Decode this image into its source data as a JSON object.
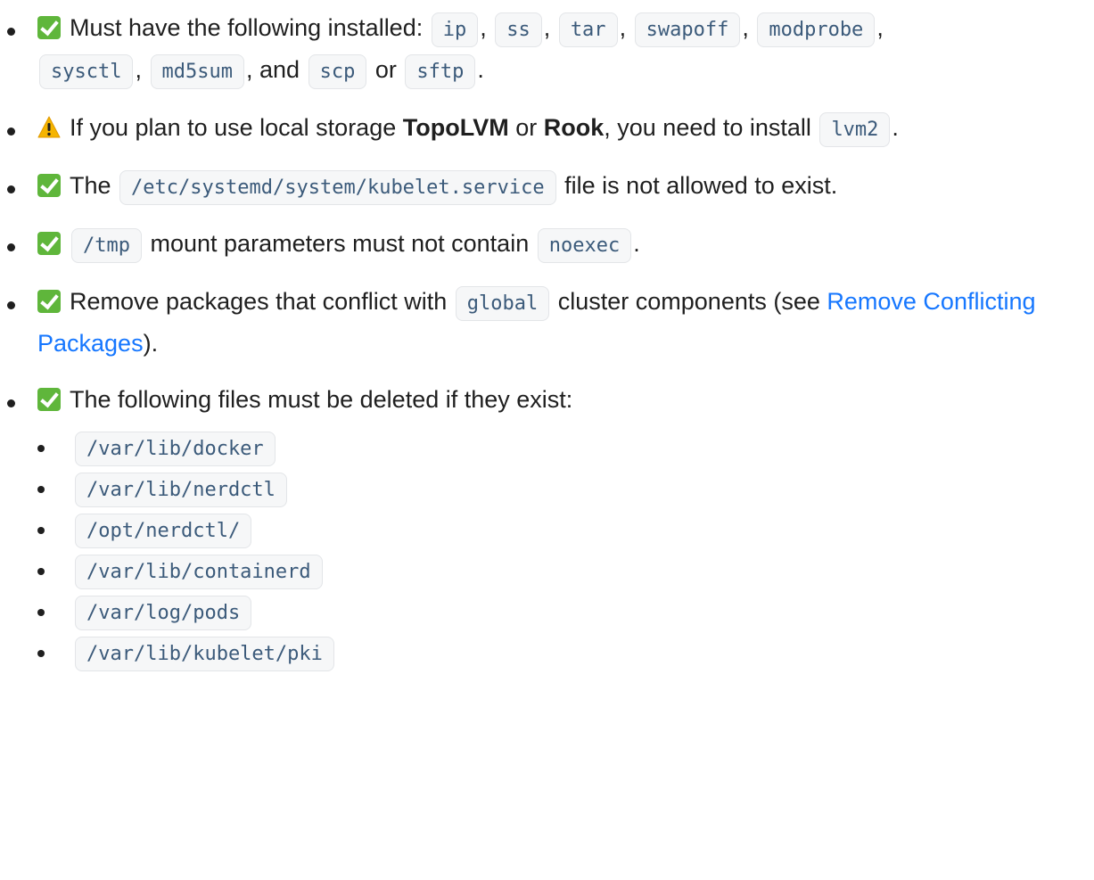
{
  "items": {
    "req1": {
      "text_a": "Must have the following installed:",
      "tools": [
        "ip",
        "ss",
        "tar",
        "swapoff",
        "modprobe",
        "sysctl",
        "md5sum",
        "scp",
        "sftp"
      ],
      "comma": ",",
      "and": ", and",
      "or": "or",
      "period": "."
    },
    "req2": {
      "text_a": "If you plan to use local storage",
      "topolvm": "TopoLVM",
      "or": "or",
      "rook": "Rook",
      "text_b": ", you need to install",
      "pkg": "lvm2",
      "period": "."
    },
    "req3": {
      "text_a": "The",
      "path": "/etc/systemd/system/kubelet.service",
      "text_b": "file is not allowed to exist."
    },
    "req4": {
      "path": "/tmp",
      "text_a": "mount parameters must not contain",
      "flag": "noexec",
      "period": "."
    },
    "req5": {
      "text_a": "Remove packages that conflict with",
      "cluster": "global",
      "text_b": "cluster components (see",
      "link": "Remove Conflicting Packages",
      "text_c": ")."
    },
    "req6": {
      "text_a": "The following files must be deleted if they exist:",
      "files": [
        "/var/lib/docker",
        "/var/lib/nerdctl",
        "/opt/nerdctl/",
        "/var/lib/containerd",
        "/var/log/pods",
        "/var/lib/kubelet/pki"
      ]
    }
  },
  "icons": {
    "check": "check-mark-button-icon",
    "warning": "warning-icon"
  },
  "colors": {
    "link": "#1677ff",
    "check": "#5fb63b",
    "warning": "#f5b400",
    "code_text": "#3b5a7a"
  }
}
